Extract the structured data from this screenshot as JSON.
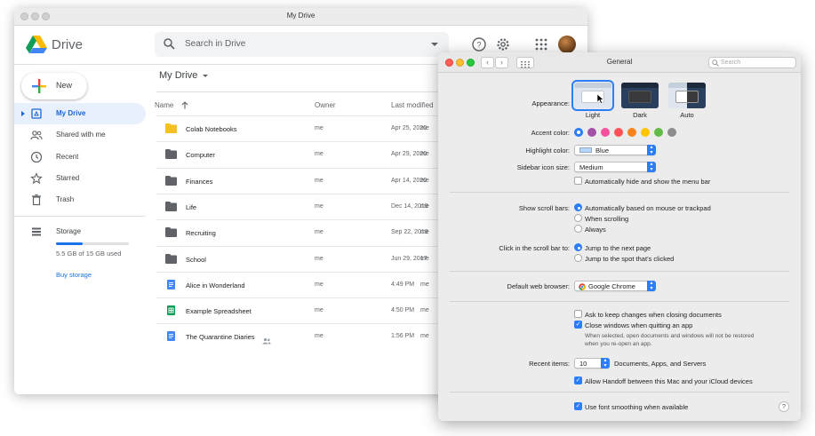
{
  "drive": {
    "window_title": "My Drive",
    "brand": "Drive",
    "search_placeholder": "Search in Drive",
    "new_button": "New",
    "nav": [
      {
        "label": "My Drive",
        "icon": "drive-icon",
        "active": true
      },
      {
        "label": "Shared with me",
        "icon": "people-icon",
        "active": false
      },
      {
        "label": "Recent",
        "icon": "clock-icon",
        "active": false
      },
      {
        "label": "Starred",
        "icon": "star-icon",
        "active": false
      },
      {
        "label": "Trash",
        "icon": "trash-icon",
        "active": false
      }
    ],
    "storage": {
      "label": "Storage",
      "used_text": "5.5 GB of 15 GB used",
      "used_fraction": 0.367,
      "buy_label": "Buy storage"
    },
    "breadcrumb": "My Drive",
    "columns": {
      "name": "Name",
      "owner": "Owner",
      "modified": "Last modified"
    },
    "files": [
      {
        "name": "Colab Notebooks",
        "type": "folder-yellow",
        "owner": "me",
        "modified": "Apr 25, 2020",
        "by": "me"
      },
      {
        "name": "Computer",
        "type": "folder",
        "owner": "me",
        "modified": "Apr 29, 2020",
        "by": "me"
      },
      {
        "name": "Finances",
        "type": "folder",
        "owner": "me",
        "modified": "Apr 14, 2020",
        "by": "me"
      },
      {
        "name": "Life",
        "type": "folder",
        "owner": "me",
        "modified": "Dec 14, 2019",
        "by": "me"
      },
      {
        "name": "Recruiting",
        "type": "folder",
        "owner": "me",
        "modified": "Sep 22, 2019",
        "by": "me"
      },
      {
        "name": "School",
        "type": "folder",
        "owner": "me",
        "modified": "Jun 29, 2017",
        "by": "me"
      },
      {
        "name": "Alice in Wonderland",
        "type": "doc",
        "owner": "me",
        "modified": "4:49 PM",
        "by": "me"
      },
      {
        "name": "Example Spreadsheet",
        "type": "sheet",
        "owner": "me",
        "modified": "4:50 PM",
        "by": "me"
      },
      {
        "name": "The Quarantine Diaries",
        "type": "doc-shared",
        "owner": "me",
        "modified": "1:56 PM",
        "by": "me"
      }
    ],
    "colors": {
      "accent": "#1a73e8",
      "active_bg": "#e8f0fe",
      "folder": "#5f6368",
      "folder_yellow": "#f6bf26",
      "doc": "#4285f4",
      "sheet": "#0f9d58"
    }
  },
  "prefs": {
    "window_title": "General",
    "search_placeholder": "Search",
    "appearance": {
      "label": "Appearance:",
      "options": [
        "Light",
        "Dark",
        "Auto"
      ],
      "selected": "Light"
    },
    "accent": {
      "label": "Accent color:",
      "colors": [
        "#2c7ef7",
        "#a550a7",
        "#f74f9e",
        "#ff5257",
        "#f7821b",
        "#ffc600",
        "#62ba46",
        "#8c8c8c"
      ],
      "selected": 0
    },
    "highlight": {
      "label": "Highlight color:",
      "value": "Blue",
      "swatch": "#b3d7ff"
    },
    "sidebar_icon": {
      "label": "Sidebar icon size:",
      "value": "Medium"
    },
    "auto_hide": {
      "label": "Automatically hide and show the menu bar",
      "checked": false
    },
    "scroll_bars": {
      "label": "Show scroll bars:",
      "options": [
        "Automatically based on mouse or trackpad",
        "When scrolling",
        "Always"
      ],
      "selected": 0
    },
    "click_scroll": {
      "label": "Click in the scroll bar to:",
      "options": [
        "Jump to the next page",
        "Jump to the spot that’s clicked"
      ],
      "selected": 0
    },
    "browser": {
      "label": "Default web browser:",
      "value": "Google Chrome"
    },
    "ask_keep": {
      "label": "Ask to keep changes when closing documents",
      "checked": false
    },
    "close_windows": {
      "label": "Close windows when quitting an app",
      "checked": true
    },
    "close_windows_note_1": "When selected, open documents and windows will not be restored",
    "close_windows_note_2": "when you re-open an app.",
    "recent": {
      "label": "Recent items:",
      "value": "10",
      "suffix": "Documents, Apps, and Servers"
    },
    "handoff": {
      "label": "Allow Handoff between this Mac and your iCloud devices",
      "checked": true
    },
    "smoothing": {
      "label": "Use font smoothing when available",
      "checked": true
    },
    "help": "?"
  }
}
